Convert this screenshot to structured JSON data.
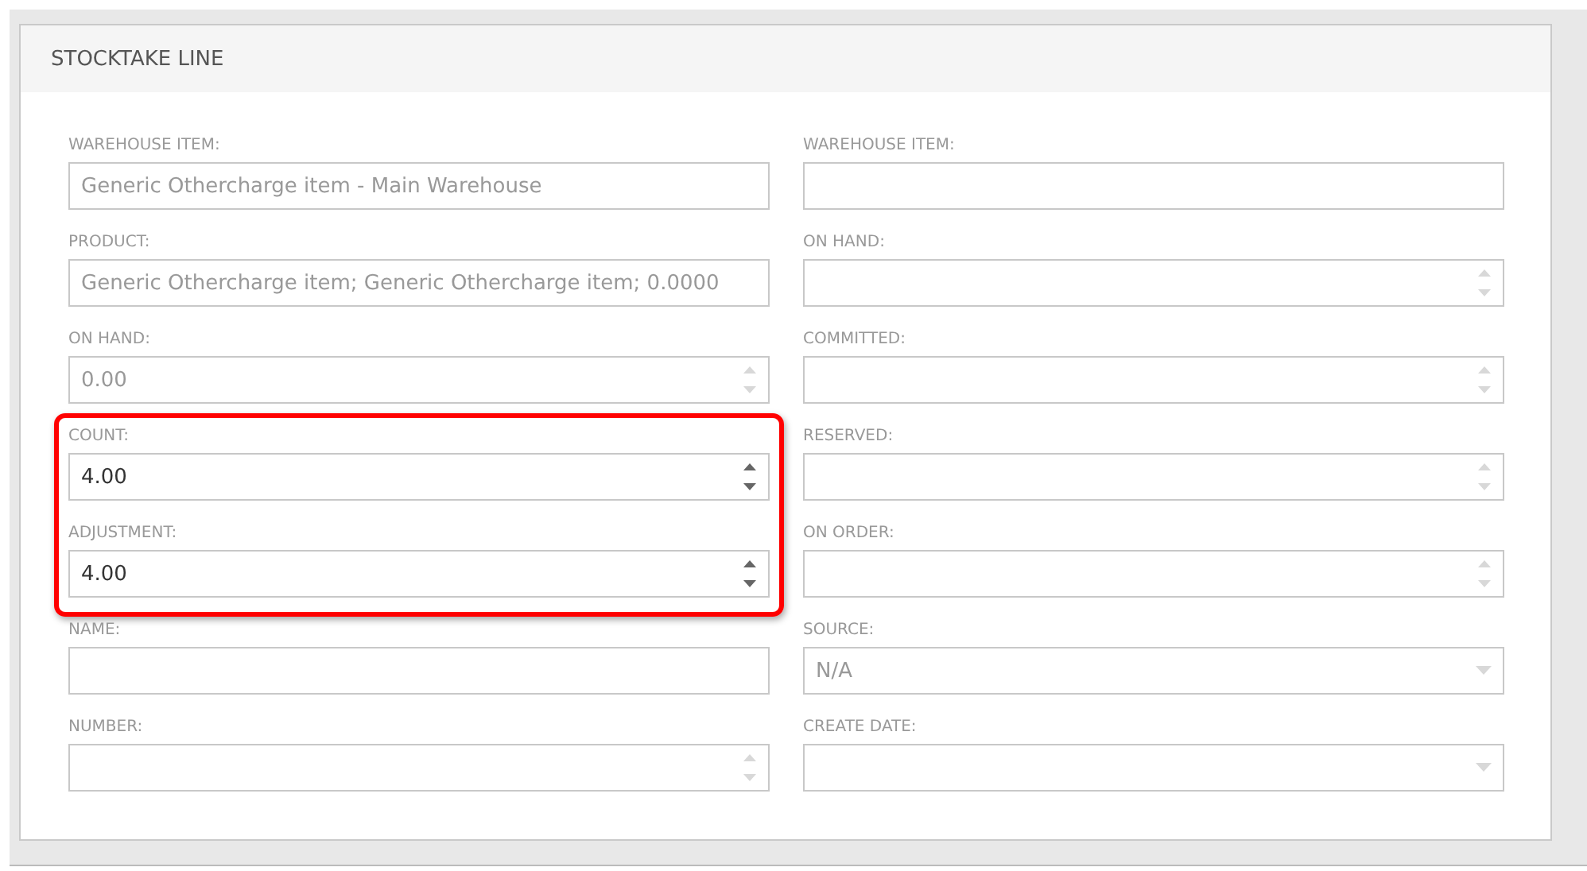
{
  "panel": {
    "title": "STOCKTAKE LINE"
  },
  "left_fields": [
    {
      "label": "WAREHOUSE ITEM:",
      "kind": "text",
      "value": "Generic Othercharge item - Main Warehouse",
      "disabled": true
    },
    {
      "label": "PRODUCT:",
      "kind": "text",
      "value": "Generic Othercharge item; Generic Othercharge item; 0.0000",
      "disabled": true
    },
    {
      "label": "ON HAND:",
      "kind": "spinner",
      "value": "0.00",
      "disabled": true
    },
    {
      "label": "COUNT:",
      "kind": "spinner",
      "value": "4.00",
      "disabled": false,
      "highlighted": true
    },
    {
      "label": "ADJUSTMENT:",
      "kind": "spinner",
      "value": "4.00",
      "disabled": false,
      "highlighted": true
    },
    {
      "label": "NAME:",
      "kind": "text"
    },
    {
      "label": "NUMBER:",
      "kind": "spinner",
      "disabled": true
    }
  ],
  "right_fields": [
    {
      "label": "WAREHOUSE ITEM:",
      "kind": "text"
    },
    {
      "label": "ON HAND:",
      "kind": "spinner",
      "disabled": true
    },
    {
      "label": "COMMITTED:",
      "kind": "spinner",
      "disabled": true
    },
    {
      "label": "RESERVED:",
      "kind": "spinner",
      "disabled": true
    },
    {
      "label": "ON ORDER:",
      "kind": "spinner",
      "disabled": true
    },
    {
      "label": "SOURCE:",
      "kind": "dropdown",
      "value": "N/A",
      "disabled": true
    },
    {
      "label": "CREATE DATE:",
      "kind": "dropdown",
      "disabled": true
    }
  ]
}
